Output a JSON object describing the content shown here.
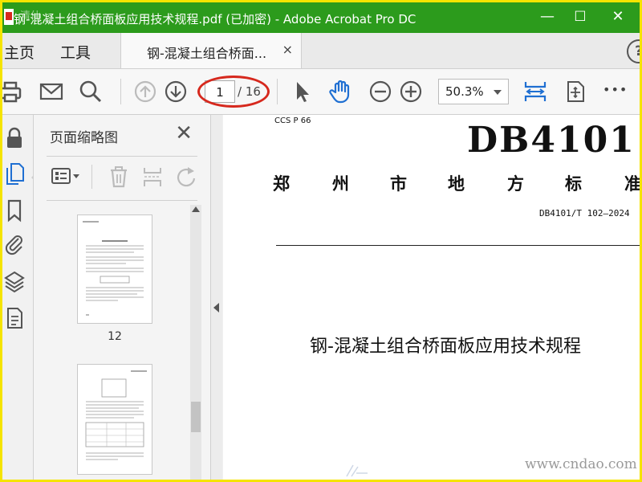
{
  "window": {
    "title": "钢-混凝土组合桥面板应用技术规程.pdf  (已加密)  - Adobe Acrobat Pro DC",
    "watermark": "清仙",
    "controls": {
      "minimize": "—",
      "maximize": "☐",
      "close": "✕"
    }
  },
  "menu": {
    "home": "主页",
    "tools": "工具"
  },
  "tab": {
    "label": "钢-混凝土组合桥面...",
    "close": "×"
  },
  "help_glyph": "?",
  "toolbar": {
    "page_current": "1",
    "page_total": "/ 16",
    "zoom": "50.3%",
    "more": "•••"
  },
  "thumbnail_panel": {
    "title": "页面缩略图",
    "close": "✕",
    "pages": [
      {
        "number": "12"
      },
      {
        "number": ""
      }
    ]
  },
  "document": {
    "ccs": "CCS  P  66",
    "standard_number": "DB4101",
    "standard_type_chars": [
      "郑",
      "州",
      "市",
      "地",
      "方",
      "标",
      "准"
    ],
    "code": "DB4101/T  102—2024",
    "title": "钢-混凝土组合桥面板应用技术规程",
    "watermark": "www.cndao.com"
  },
  "colors": {
    "titlebar": "#2c9b1c",
    "frame": "#f5e400",
    "accent_blue": "#1f6fd2",
    "annotation_red": "#d6281d"
  }
}
